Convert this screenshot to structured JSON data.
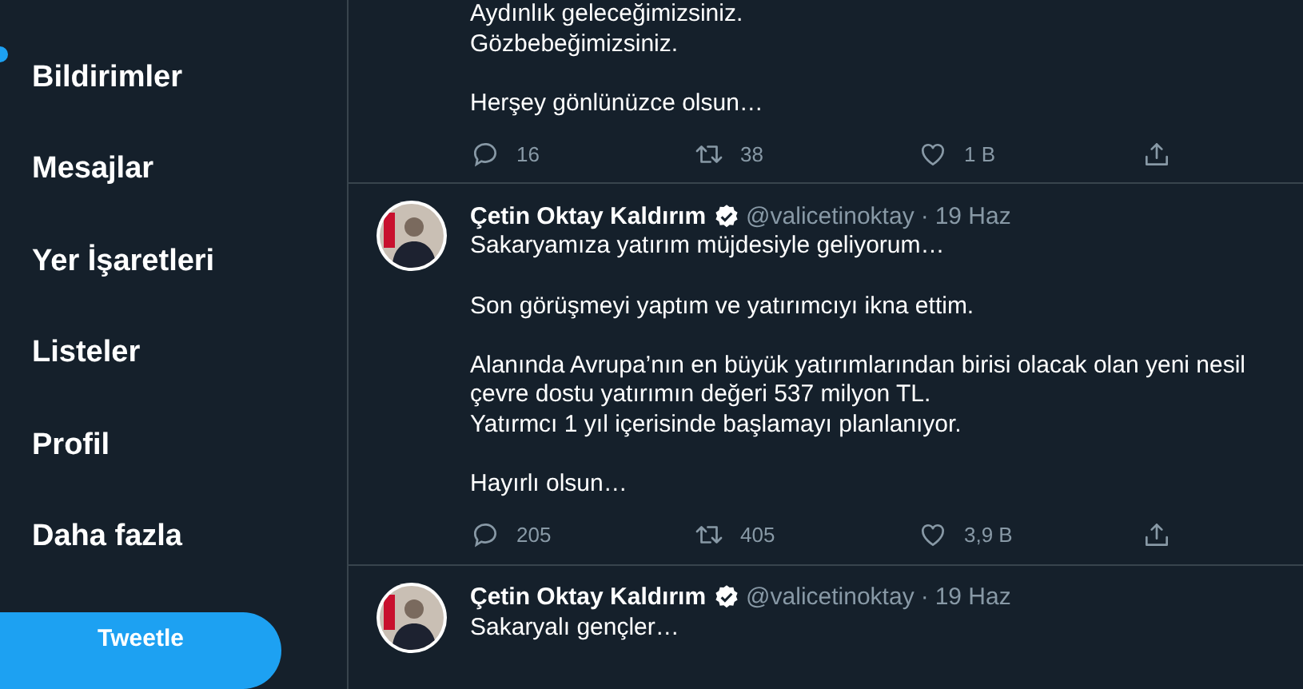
{
  "sidebar": {
    "items": [
      {
        "label": "Bildirimler"
      },
      {
        "label": "Mesajlar"
      },
      {
        "label": "Yer İşaretleri"
      },
      {
        "label": "Listeler"
      },
      {
        "label": "Profil"
      },
      {
        "label": "Daha fazla"
      }
    ],
    "tweet_button": "Tweetle"
  },
  "tweets": [
    {
      "paragraphs": [
        "Aydınlık geleceğimizsiniz.\nGözbebeğimizsiniz.",
        "Herşey gönlünüzce olsun…"
      ],
      "replies": "16",
      "retweets": "38",
      "likes": "1 B"
    },
    {
      "author": {
        "name": "Çetin Oktay Kaldırım",
        "verified": true,
        "handle": "@valicetinoktay",
        "separator": "·",
        "date": "19 Haz"
      },
      "paragraphs": [
        "Sakaryamıza yatırım müjdesiyle geliyorum…",
        "Son görüşmeyi yaptım ve yatırımcıyı ikna ettim.",
        "Alanında Avrupa’nın en büyük yatırımlarından birisi olacak olan yeni nesil\nçevre dostu yatırımın değeri 537 milyon TL.\nYatırmcı 1 yıl içerisinde başlamayı planlanıyor.",
        "Hayırlı olsun…"
      ],
      "replies": "205",
      "retweets": "405",
      "likes": "3,9 B"
    },
    {
      "author": {
        "name": "Çetin Oktay Kaldırım",
        "verified": true,
        "handle": "@valicetinoktay",
        "separator": "·",
        "date": "19 Haz"
      },
      "paragraphs": [
        "Sakaryalı gençler…"
      ]
    }
  ]
}
